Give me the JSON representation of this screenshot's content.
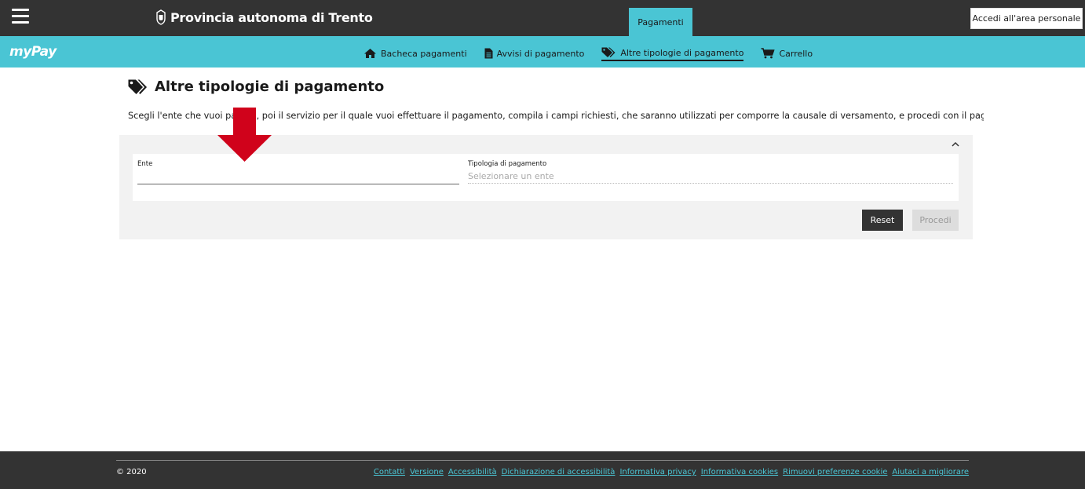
{
  "header": {
    "brand_title": "Provincia autonoma di Trento",
    "tab_label": "Pagamenti",
    "login_label": "Accedi all'area personale"
  },
  "nav": {
    "logo_my": "my",
    "logo_pay": "Pay",
    "items": [
      {
        "label": "Bacheca pagamenti",
        "icon": "home-icon"
      },
      {
        "label": "Avvisi di pagamento",
        "icon": "document-icon"
      },
      {
        "label": "Altre tipologie di pagamento",
        "icon": "tags-icon",
        "active": true
      },
      {
        "label": "Carrello",
        "icon": "cart-icon"
      }
    ]
  },
  "main": {
    "title": "Altre tipologie di pagamento",
    "intro": "Scegli l'ente che vuoi pagare, poi il servizio per il quale vuoi effettuare il pagamento, compila i campi richiesti, che saranno utilizzati per comporre la causale di versamento, e procedi con il pagamento",
    "ente_label": "Ente",
    "ente_value": "",
    "tipologia_label": "Tipologia di pagamento",
    "tipologia_placeholder": "Selezionare un ente",
    "reset_label": "Reset",
    "procedi_label": "Procedi"
  },
  "footer": {
    "copyright": "© 2020",
    "links": [
      "Contatti",
      "Versione",
      "Accessibilità",
      "Dichiarazione di accessibilità",
      "Informativa privacy",
      "Informativa cookies",
      "Rimuovi preferenze cookie",
      "Aiutaci a migliorare"
    ]
  },
  "colors": {
    "dark": "#333333",
    "accent": "#4ac5d4",
    "arrow": "#d0021b"
  }
}
